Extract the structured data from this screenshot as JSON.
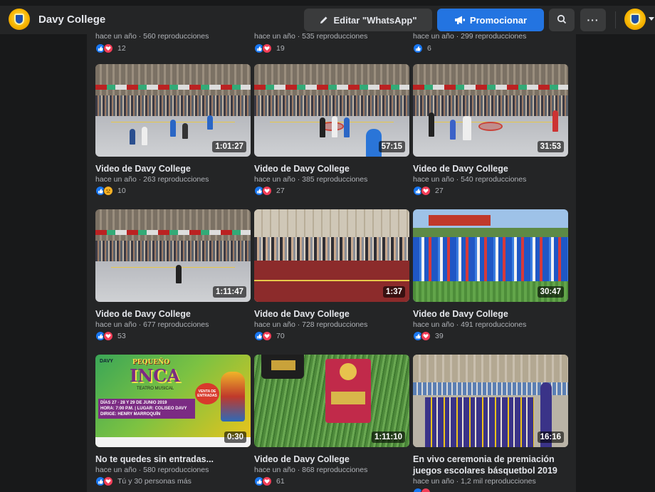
{
  "header": {
    "page_name": "Davy College",
    "edit_label": "Editar \"WhatsApp\"",
    "promote_label": "Promocionar",
    "more_label": "···"
  },
  "top_partial": [
    {
      "meta": "hace un año · 560 reproducciones",
      "count": "12"
    },
    {
      "meta": "hace un año · 535 reproducciones",
      "count": "19"
    },
    {
      "meta": "hace un año · 299 reproducciones",
      "count": "6"
    }
  ],
  "videos": [
    {
      "title": "Video de Davy College",
      "duration": "1:01:27",
      "meta": "hace un año · 263 reproducciones",
      "count": "10"
    },
    {
      "title": "Video de Davy College",
      "duration": "57:15",
      "meta": "hace un año · 385 reproducciones",
      "count": "27"
    },
    {
      "title": "Video de Davy College",
      "duration": "31:53",
      "meta": "hace un año · 540 reproducciones",
      "count": "27"
    },
    {
      "title": "Video de Davy College",
      "duration": "1:11:47",
      "meta": "hace un año · 677 reproducciones",
      "count": "53"
    },
    {
      "title": "Video de Davy College",
      "duration": "1:37",
      "meta": "hace un año · 728 reproducciones",
      "count": "70"
    },
    {
      "title": "Video de Davy College",
      "duration": "30:47",
      "meta": "hace un año · 491 reproducciones",
      "count": "39"
    },
    {
      "title": "No te quedes sin entradas...",
      "duration": "0:30",
      "meta": "hace un año · 580 reproducciones",
      "count": "Tú y 30 personas más"
    },
    {
      "title": "Video de Davy College",
      "duration": "1:11:10",
      "meta": "hace un año · 868 reproducciones",
      "count": "61"
    },
    {
      "title": "En vivo ceremonia de premiación juegos escolares básquetbol 2019",
      "duration": "16:16",
      "meta": "hace un año · 1,2 mil reproducciones",
      "count": ""
    }
  ],
  "poster": {
    "brand": "DAVY",
    "headline_top": "PEQUEÑO",
    "headline_big": "INCA",
    "subtitle": "TEATRO MUSICAL",
    "lines": [
      "DÍAS 27 · 28 Y 29 DE JUNIO 2019",
      "HORA: 7:00 P.M. | LUGAR: COLISEO DAVY",
      "DIRIGE: HENRY MARROQUÍN"
    ],
    "stamp": "VENTA DE ENTRADAS"
  },
  "colors": {
    "accent": "#2374e1",
    "like": "#1877f2",
    "love": "#f33e58",
    "sad": "#f7b125"
  }
}
